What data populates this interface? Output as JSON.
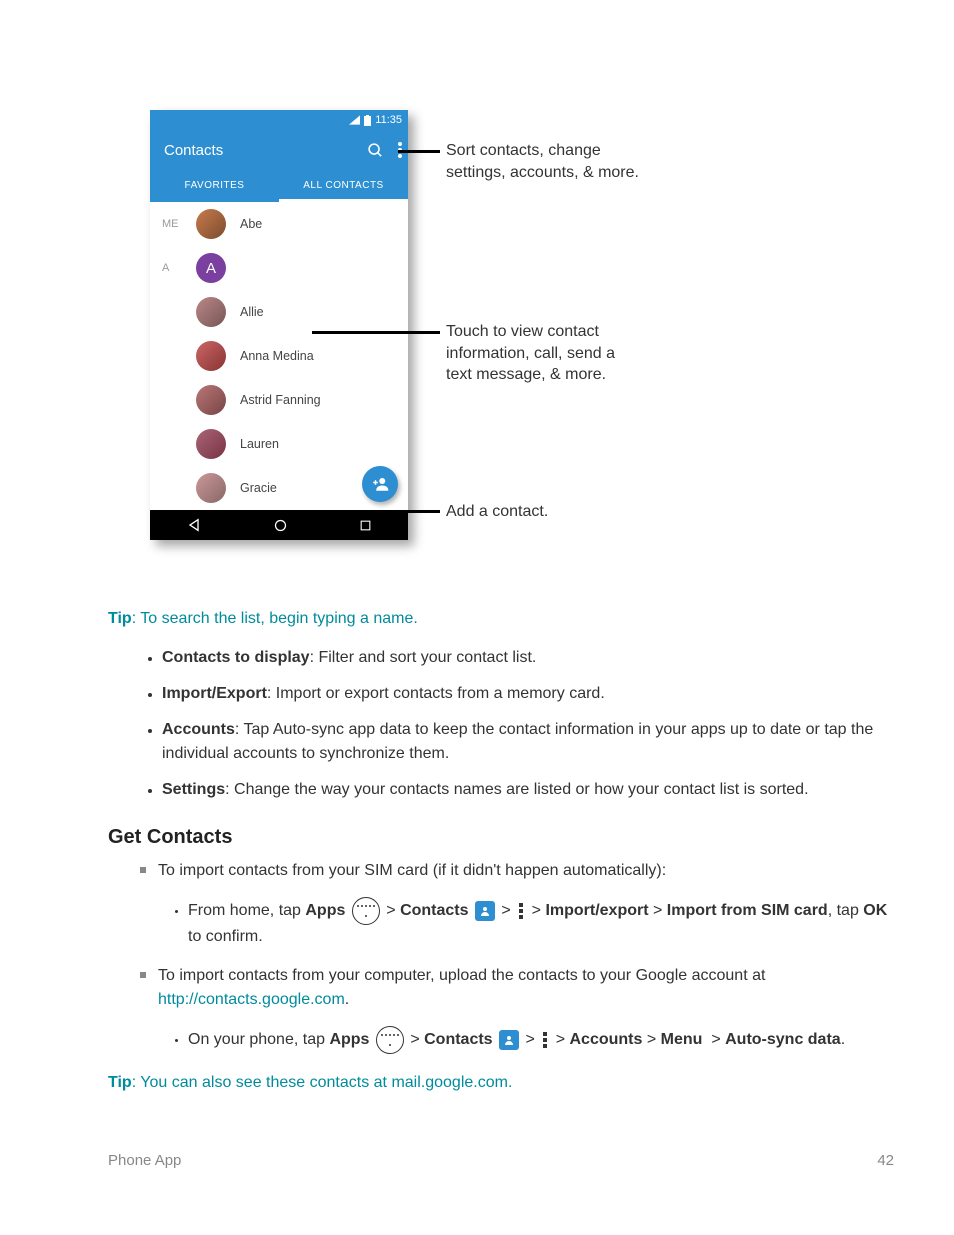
{
  "phone": {
    "time": "11:35",
    "app_title": "Contacts",
    "tabs": {
      "favorites": "FAVORITES",
      "all": "ALL CONTACTS"
    },
    "sections": {
      "me": "ME",
      "a": "A"
    },
    "contacts": {
      "c0": "Abe",
      "avatar_letter": "A",
      "c1": "Allie",
      "c2": "Anna Medina",
      "c3": "Astrid Fanning",
      "c4": "Lauren",
      "c5": "Gracie"
    }
  },
  "callouts": {
    "menu_l1": "Sort contacts, change",
    "menu_l2": "settings, accounts, & more.",
    "contact_l1": "Touch to view contact",
    "contact_l2": "information, call, send a",
    "contact_l3": "text message, & more.",
    "fab": "Add a contact."
  },
  "tip1_label": "Tip",
  "tip1_text": ": To search the list, begin typing a name.",
  "bullets": {
    "b1_bold": "Contacts to display",
    "b1_rest": ": Filter and sort your contact list.",
    "b2_bold": "Import/Export",
    "b2_rest": ": Import or export contacts from a memory card.",
    "b3_bold": "Accounts",
    "b3_rest": ": Tap Auto-sync app data to keep the contact information in your apps up to date or tap the individual accounts to synchronize them.",
    "b4_bold": "Settings",
    "b4_rest": ": Change the way your contacts names are listed or how your contact list is sorted."
  },
  "heading": "Get Contacts",
  "steps": {
    "s1": "To import contacts from your SIM card (if it didn't happen automatically):",
    "s1a_pre": "From home, tap ",
    "s1a_apps": "Apps",
    "s1a_contacts": "Contacts",
    "s1a_import": "Import/export",
    "s1a_import_sim": "Import from SIM card",
    "s1a_post": ", tap ",
    "s1a_ok": "OK",
    "s1a_confirm": " to confirm.",
    "s2_pre": "To import contacts from your computer, upload the contacts to your Google account at ",
    "s2_link": "http://contacts.google.com",
    "s2_post": ".",
    "s2a_pre": "On your phone, tap ",
    "s2a_apps": "Apps",
    "s2a_contacts": "Contacts",
    "s2a_accounts": "Accounts",
    "s2a_menu": "Menu",
    "s2a_auto": "Auto-sync data",
    "s2a_post": "."
  },
  "tip2_label": "Tip",
  "tip2_pre": ": You can also see these contacts at ",
  "tip2_link": "mail.google.com",
  "tip2_post": ".",
  "footer": {
    "left": "Phone App",
    "right": "42"
  }
}
